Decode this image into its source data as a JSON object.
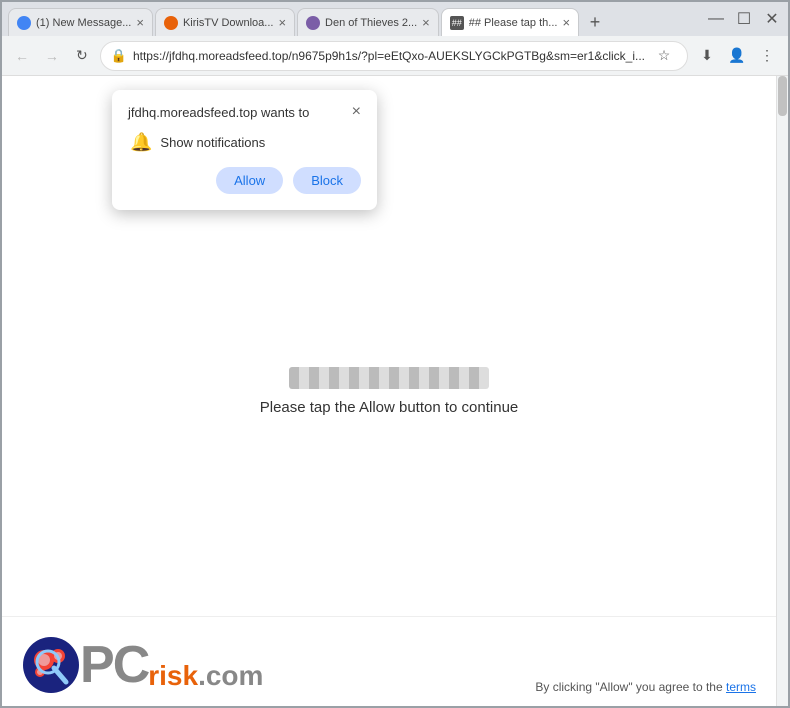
{
  "browser": {
    "tabs": [
      {
        "id": "tab1",
        "title": "(1) New Message...",
        "favicon": "circle-blue",
        "active": false
      },
      {
        "id": "tab2",
        "title": "KirisTV Downloa...",
        "favicon": "circle-orange",
        "active": false
      },
      {
        "id": "tab3",
        "title": "Den of Thieves 2...",
        "favicon": "circle-purple",
        "active": false
      },
      {
        "id": "tab4",
        "title": "## Please tap th...",
        "favicon": "hash",
        "active": true
      }
    ],
    "new_tab_label": "+",
    "window_controls": [
      "—",
      "☐",
      "✕"
    ],
    "nav": {
      "back_label": "←",
      "forward_label": "→",
      "reload_label": "↻",
      "address": "https://jfdhq.moreadsfeed.top/n9675p9h1s/?pl=eEtQxo-AUEKSLYGCkPGTBg&sm=er1&click_i...",
      "bookmark_label": "☆",
      "download_label": "⬇",
      "account_label": "👤",
      "menu_label": "⋮"
    }
  },
  "popup": {
    "title": "jfdhq.moreadsfeed.top wants to",
    "close_label": "×",
    "body_text": "Show notifications",
    "allow_label": "Allow",
    "block_label": "Block"
  },
  "page": {
    "main_text": "Please tap the Allow button to continue"
  },
  "footer": {
    "logo_pc": "PC",
    "logo_risk": "risk",
    "logo_com": ".com",
    "terms_text": "By clicking \"Allow\" you agree to the",
    "terms_link": "terms"
  }
}
